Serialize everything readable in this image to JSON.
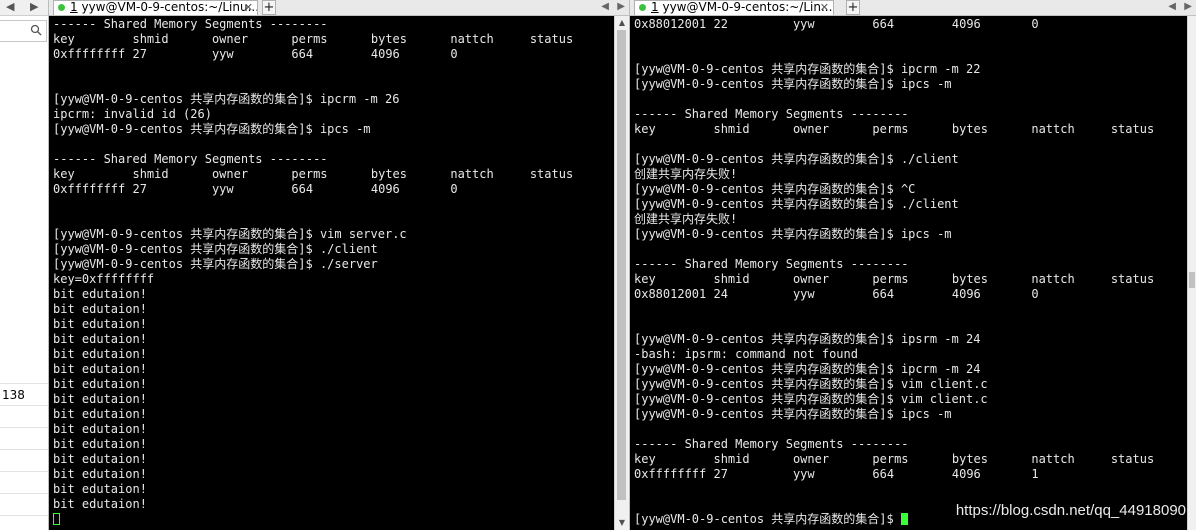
{
  "left_strip": {
    "nav_left": "◀",
    "nav_right": "▶",
    "row_value": "138"
  },
  "left_pane": {
    "tab_index": "1",
    "tab_title": "yyw@VM-0-9-centos:~/Linu...",
    "tab_close": "✕",
    "new_tab": "+",
    "lines": [
      "------ Shared Memory Segments --------",
      "key        shmid      owner      perms      bytes      nattch     status",
      "0xffffffff 27         yyw        664        4096       0",
      "",
      "",
      "[yyw@VM-0-9-centos 共享内存函数的集合]$ ipcrm -m 26",
      "ipcrm: invalid id (26)",
      "[yyw@VM-0-9-centos 共享内存函数的集合]$ ipcs -m",
      "",
      "------ Shared Memory Segments --------",
      "key        shmid      owner      perms      bytes      nattch     status",
      "0xffffffff 27         yyw        664        4096       0",
      "",
      "",
      "[yyw@VM-0-9-centos 共享内存函数的集合]$ vim server.c",
      "[yyw@VM-0-9-centos 共享内存函数的集合]$ ./client",
      "[yyw@VM-0-9-centos 共享内存函数的集合]$ ./server",
      "key=0xffffffff",
      "bit edutaion!",
      "bit edutaion!",
      "bit edutaion!",
      "bit edutaion!",
      "bit edutaion!",
      "bit edutaion!",
      "bit edutaion!",
      "bit edutaion!",
      "bit edutaion!",
      "bit edutaion!",
      "bit edutaion!",
      "bit edutaion!",
      "bit edutaion!",
      "bit edutaion!",
      "bit edutaion!"
    ]
  },
  "right_pane": {
    "tab_index": "1",
    "tab_title": "yyw@VM-0-9-centos:~/Lin...",
    "tab_close": "✕",
    "new_tab": "+",
    "lines": [
      "0x88012001 22         yyw        664        4096       0",
      "",
      "",
      "[yyw@VM-0-9-centos 共享内存函数的集合]$ ipcrm -m 22",
      "[yyw@VM-0-9-centos 共享内存函数的集合]$ ipcs -m",
      "",
      "------ Shared Memory Segments --------",
      "key        shmid      owner      perms      bytes      nattch     status",
      "",
      "[yyw@VM-0-9-centos 共享内存函数的集合]$ ./client",
      "创建共享内存失败!",
      "[yyw@VM-0-9-centos 共享内存函数的集合]$ ^C",
      "[yyw@VM-0-9-centos 共享内存函数的集合]$ ./client",
      "创建共享内存失败!",
      "[yyw@VM-0-9-centos 共享内存函数的集合]$ ipcs -m",
      "",
      "------ Shared Memory Segments --------",
      "key        shmid      owner      perms      bytes      nattch     status",
      "0x88012001 24         yyw        664        4096       0",
      "",
      "",
      "[yyw@VM-0-9-centos 共享内存函数的集合]$ ipsrm -m 24",
      "-bash: ipsrm: command not found",
      "[yyw@VM-0-9-centos 共享内存函数的集合]$ ipcrm -m 24",
      "[yyw@VM-0-9-centos 共享内存函数的集合]$ vim client.c",
      "[yyw@VM-0-9-centos 共享内存函数的集合]$ vim client.c",
      "[yyw@VM-0-9-centos 共享内存函数的集合]$ ipcs -m",
      "",
      "------ Shared Memory Segments --------",
      "key        shmid      owner      perms      bytes      nattch     status",
      "0xffffffff 27         yyw        664        4096       1",
      "",
      "",
      "[yyw@VM-0-9-centos 共享内存函数的集合]$ "
    ]
  },
  "watermark": "https://blog.csdn.net/qq_44918090",
  "colors": {
    "terminal_bg": "#000000",
    "terminal_fg": "#e8e8e8",
    "cursor": "#39ff39",
    "tab_dot": "#3cc13c"
  }
}
